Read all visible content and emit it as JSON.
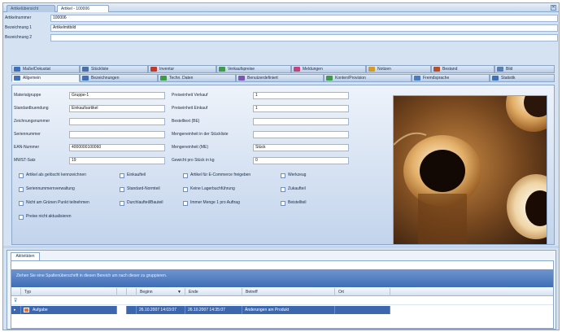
{
  "doc_tabs": [
    "Artikelübersicht",
    "Artikel - 100006"
  ],
  "header": {
    "fields": [
      {
        "label": "Artikelnummer",
        "value": "100006"
      },
      {
        "label": "Bezeichnung 1",
        "value": "Artikelmitbild"
      },
      {
        "label": "Bezeichnung 2",
        "value": ""
      }
    ]
  },
  "tabs_row1": [
    {
      "label": "Maße/Dokustat",
      "icon_color": "#3f6fb5"
    },
    {
      "label": "Stückliste",
      "icon_color": "#4a6fa0"
    },
    {
      "label": "Inventur",
      "icon_color": "#c0392b"
    },
    {
      "label": "Verkaufspreise",
      "icon_color": "#3f9a4a"
    },
    {
      "label": "Meldungen",
      "icon_color": "#c0457a"
    },
    {
      "label": "Notizen",
      "icon_color": "#d49a2a"
    },
    {
      "label": "Bestand",
      "icon_color": "#b5502a"
    },
    {
      "label": "Bild",
      "icon_color": "#5a7fb0"
    }
  ],
  "tabs_row2": [
    {
      "label": "Allgemein",
      "icon_color": "#3f6fb5"
    },
    {
      "label": "Bezeichnungen",
      "icon_color": "#3f6fb5"
    },
    {
      "label": "Techn. Daten",
      "icon_color": "#3f9a4a"
    },
    {
      "label": "Benutzerdefiniert",
      "icon_color": "#7a5ab0"
    },
    {
      "label": "Konten/Provision",
      "icon_color": "#3f9a4a"
    },
    {
      "label": "Fremdsprache",
      "icon_color": "#4a7ac0"
    },
    {
      "label": "Statistik",
      "icon_color": "#3f6fb5"
    }
  ],
  "form": {
    "left": [
      {
        "label": "Materialgruppe",
        "value": "Gruppe-1"
      },
      {
        "label": "Standardbuendung",
        "value": "Einkaufsartikel"
      },
      {
        "label": "Zeichnungsnummer",
        "value": ""
      },
      {
        "label": "Seriennummer",
        "value": ""
      },
      {
        "label": "EAN-Nummer",
        "value": "4000000100060"
      },
      {
        "label": "MWST-Satz",
        "value": "19"
      }
    ],
    "right": [
      {
        "label": "Preiseinheit Verkauf",
        "value": "1"
      },
      {
        "label": "Preiseinheit Einkauf",
        "value": "1"
      },
      {
        "label": "Bestelltext (BE)",
        "value": ""
      },
      {
        "label": "Mengeneinheit in der Stückliste",
        "value": ""
      },
      {
        "label": "Mengeneinheit (ME)",
        "value": "Stück"
      },
      {
        "label": "Gewicht pro Stück in kg",
        "value": "0"
      }
    ]
  },
  "checkboxes": [
    [
      "Artikel als gelöscht kennzeichnen",
      "Einkaufteil",
      "Artikel für E-Commerce freigeben",
      "Werkzeug"
    ],
    [
      "Seriennummernverwaltung",
      "Standard-Normteil",
      "Keine Lagerbuchführung",
      "Zukaufteil"
    ],
    [
      "Nicht am Grünen Punkt teilnehmen",
      "Durchlaufteil/Bauteil",
      "Immer Menge 1 pro Auftrag",
      "Beistellteil"
    ],
    [
      "Preise nicht aktualisieren"
    ]
  ],
  "bottom": {
    "tab": "Aktivitäten",
    "group_hint": "Ziehen Sie eine Spaltenüberschrift in diesen Bereich um nach dieser zu gruppieren.",
    "columns": [
      "Typ",
      "Beginn",
      "Ende",
      "Betreff",
      "Ort"
    ],
    "rows": [
      {
        "type": "Aufgabe",
        "begin": "26.10.2007 14:03:07",
        "end": "26.10.2007 14:35:07",
        "subject": "Änderungen am Produkt",
        "location": ""
      }
    ]
  }
}
